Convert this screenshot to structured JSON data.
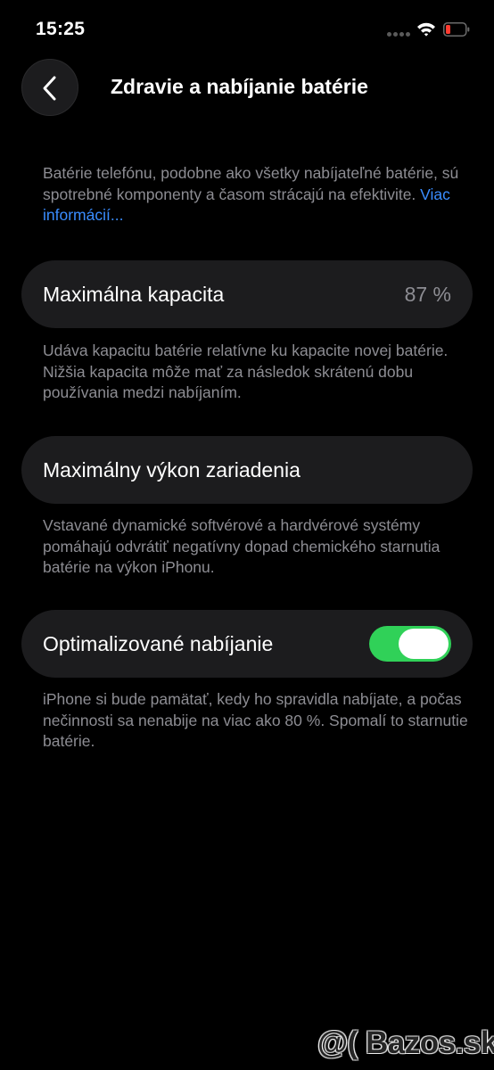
{
  "status_bar": {
    "time": "15:25",
    "icons": [
      "signal-icon",
      "wifi-icon",
      "battery-icon"
    ],
    "battery_color": "#ff3b30"
  },
  "header": {
    "back_icon": "chevron-left-icon",
    "title": "Zdravie a nabíjanie batérie"
  },
  "intro": {
    "text": "Batérie telefónu, podobne ako všetky nabíjateľné batérie, sú spotrebné komponenty a časom strácajú na efektivite. ",
    "link": "Viac informácií..."
  },
  "max_capacity": {
    "label": "Maximálna kapacita",
    "value": "87 %",
    "description": "Udáva kapacitu batérie relatívne ku kapacite novej batérie. Nižšia kapacita môže mať za následok skrátenú dobu používania medzi nabíjaním."
  },
  "peak_performance": {
    "label": "Maximálny výkon zariadenia",
    "description": "Vstavané dynamické softvérové a hardvérové systémy pomáhajú odvrátiť negatívny dopad chemického starnutia batérie na výkon iPhonu."
  },
  "optimized_charging": {
    "label": "Optimalizované nabíjanie",
    "enabled": true,
    "toggle_color": "#30d158",
    "description": "iPhone si bude pamätať, kedy ho spravidla nabíjate, a počas nečinnosti sa nenabije na viac ako 80 %. Spomalí to starnutie batérie."
  },
  "watermark": {
    "text": "@( Bazos.sk"
  },
  "colors": {
    "background": "#000000",
    "card": "#1c1c1e",
    "secondary_text": "#8d8d93",
    "link": "#3a8dff"
  }
}
